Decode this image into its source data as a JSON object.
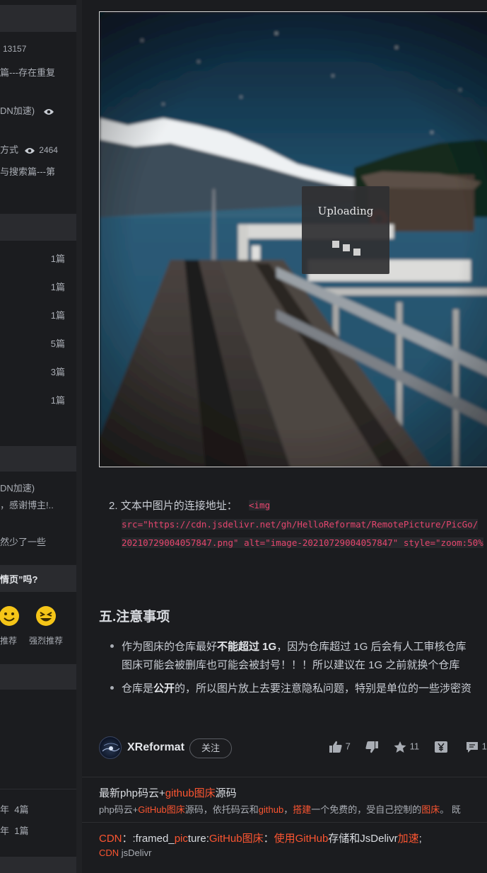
{
  "sidebar": {
    "popular": [
      {
        "text": "13157"
      },
      {
        "text": "篇---存在重复"
      },
      {
        "text": "DN加速)"
      },
      {
        "text": "方式",
        "views": "2464"
      },
      {
        "text": "与搜索篇---第"
      }
    ],
    "categories": [
      {
        "count": "1篇"
      },
      {
        "count": "1篇"
      },
      {
        "count": "1篇"
      },
      {
        "count": "5篇"
      },
      {
        "count": "3篇"
      },
      {
        "count": "1篇"
      }
    ],
    "comments": [
      {
        "text": "DN加速)"
      },
      {
        "text": "，感谢博主!.."
      },
      {
        "text": "然少了一些"
      }
    ],
    "question": "情页”吗?",
    "ratings": [
      "推荐",
      "强烈推荐"
    ],
    "archives": [
      {
        "year": "年",
        "count": "4篇"
      },
      {
        "year": "年",
        "count": "1篇"
      }
    ]
  },
  "article": {
    "uploading_text": "Uploading",
    "list_item_2": {
      "number": "2.",
      "label": "文本中图片的连接地址：",
      "code_line1": "<img",
      "code_line2": "src=\"https://cdn.jsdelivr.net/gh/HelloReformat/RemotePicture/PicGo/",
      "code_line3": "20210729004057847.png\" alt=\"image-20210729004057847\" style=\"zoom:50%"
    },
    "section_title": "五.注意事项",
    "bullets": [
      {
        "pre": "作为图床的仓库最好",
        "bold": "不能超过 1G",
        "post": "，因为仓库超过 1G 后会有人工审核仓库",
        "line2": "图床可能会被删库也可能会被封号！！！所以建议在 1G 之前就换个仓库"
      },
      {
        "pre": "仓库是",
        "bold": "公开",
        "post": "的，所以图片放上去要注意隐私问题，特别是单位的一些涉密资"
      }
    ]
  },
  "author": {
    "name": "XReformat",
    "follow_label": "关注",
    "likes": "7",
    "favorites": "11",
    "comments": "1"
  },
  "recommendations": [
    {
      "title_parts": [
        {
          "t": "最新php码云+",
          "hl": false
        },
        {
          "t": "github图床",
          "hl": true
        },
        {
          "t": "源码",
          "hl": false
        }
      ],
      "desc_parts": [
        {
          "t": "php码云+",
          "hl": false
        },
        {
          "t": "GitHub图床",
          "hl": true
        },
        {
          "t": "源码，依托码云和",
          "hl": false
        },
        {
          "t": "github",
          "hl": true
        },
        {
          "t": "，",
          "hl": false
        },
        {
          "t": "搭建",
          "hl": true
        },
        {
          "t": "一个免费的，受自己控制的",
          "hl": false
        },
        {
          "t": "图床",
          "hl": true
        },
        {
          "t": "。 既",
          "hl": false
        }
      ]
    },
    {
      "title_parts": [
        {
          "t": "CDN",
          "hl": true
        },
        {
          "t": "：:framed_",
          "hl": false
        },
        {
          "t": "pic",
          "hl": true
        },
        {
          "t": "ture:",
          "hl": false
        },
        {
          "t": "GitHub图床",
          "hl": true
        },
        {
          "t": "：",
          "hl": false
        },
        {
          "t": "使用GitHub",
          "hl": true
        },
        {
          "t": "存储和JsDelivr",
          "hl": false
        },
        {
          "t": "加速",
          "hl": true
        },
        {
          "t": ";",
          "hl": false
        }
      ],
      "desc_parts": [
        {
          "t": "CDN",
          "hl": true
        },
        {
          "t": " jsDelivr",
          "hl": false
        }
      ]
    }
  ]
}
